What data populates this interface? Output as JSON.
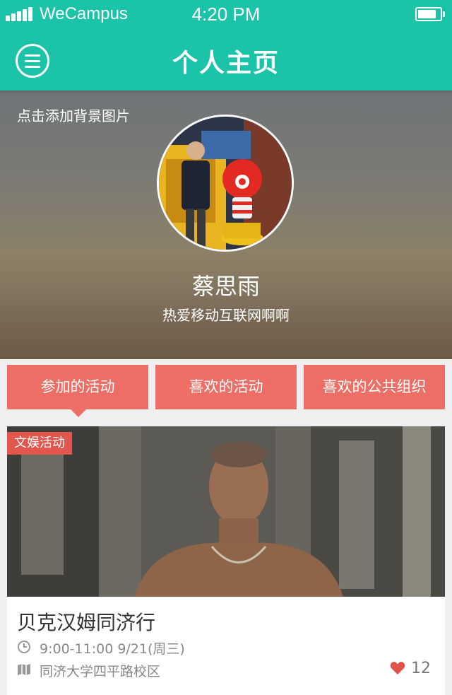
{
  "status_bar": {
    "carrier": "WeCampus",
    "time": "4:20 PM",
    "battery_level": 0.95,
    "signal_bars": 5
  },
  "nav": {
    "title": "个人主页",
    "menu_icon": "hamburger-menu-icon"
  },
  "profile": {
    "add_background_label": "点击添加背景图片",
    "name": "蔡思雨",
    "bio": "热爱移动互联网啊啊"
  },
  "tabs": [
    {
      "label": "参加的活动",
      "selected": true
    },
    {
      "label": "喜欢的活动",
      "selected": false
    },
    {
      "label": "喜欢的公共组织",
      "selected": false
    }
  ],
  "activity": {
    "category_badge": "文娱活动",
    "title": "贝克汉姆同济行",
    "time": "9:00-11:00 9/21(周三)",
    "location": "同济大学四平路校区",
    "likes": "12",
    "icons": {
      "time": "clock-icon",
      "location": "map-icon",
      "likes": "heart-icon"
    }
  },
  "colors": {
    "accent": "#1bc3a8",
    "tab": "#ec6e65",
    "badge": "#e2564d",
    "heart": "#e0534a"
  }
}
